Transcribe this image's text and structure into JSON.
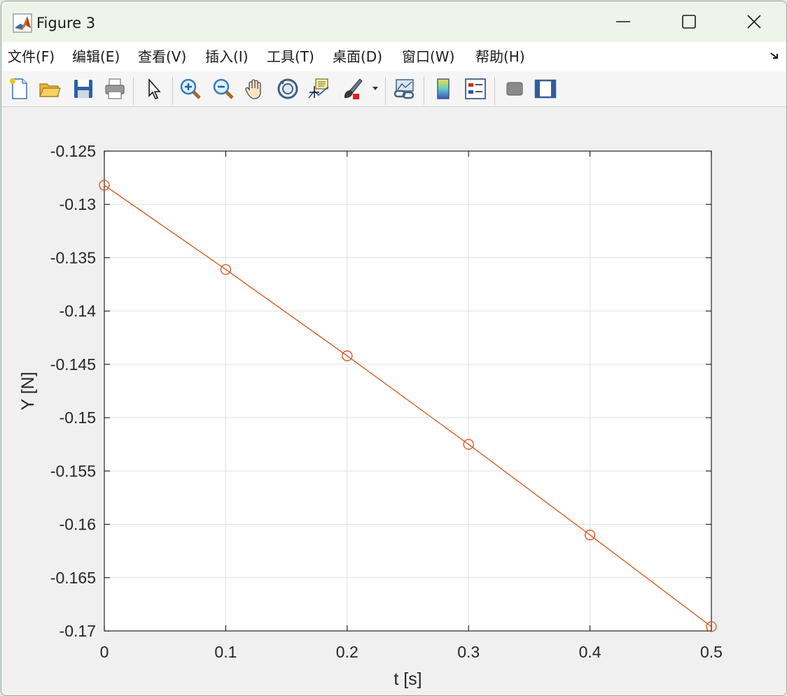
{
  "window": {
    "title": "Figure 3"
  },
  "menu": [
    {
      "label": "文件(F)"
    },
    {
      "label": "编辑(E)"
    },
    {
      "label": "查看(V)"
    },
    {
      "label": "插入(I)"
    },
    {
      "label": "工具(T)"
    },
    {
      "label": "桌面(D)"
    },
    {
      "label": "窗口(W)"
    },
    {
      "label": "帮助(H)"
    }
  ],
  "toolbar": [
    {
      "icon": "new-figure-icon"
    },
    {
      "icon": "open-folder-icon"
    },
    {
      "icon": "save-icon"
    },
    {
      "icon": "print-icon"
    },
    {
      "icon": "edit-pointer-icon"
    },
    {
      "icon": "zoom-in-icon"
    },
    {
      "icon": "zoom-out-icon"
    },
    {
      "icon": "pan-hand-icon"
    },
    {
      "icon": "rotate-3d-icon"
    },
    {
      "icon": "data-cursor-icon"
    },
    {
      "icon": "brush-icon"
    },
    {
      "icon": "link-plot-icon"
    },
    {
      "icon": "colorbar-icon"
    },
    {
      "icon": "legend-icon"
    },
    {
      "icon": "hide-plot-tools-icon"
    },
    {
      "icon": "show-plot-tools-icon"
    }
  ],
  "colors": {
    "series": "#d95319",
    "grid": "#e1e1e1",
    "axes": "#262626"
  },
  "chart_data": {
    "type": "line",
    "title": "",
    "xlabel": "t [s]",
    "ylabel": "Y [N]",
    "xlim": [
      0,
      0.5
    ],
    "ylim": [
      -0.17,
      -0.125
    ],
    "xticks": [
      "0",
      "0.1",
      "0.2",
      "0.3",
      "0.4",
      "0.5"
    ],
    "yticks": [
      "-0.125",
      "-0.13",
      "-0.135",
      "-0.14",
      "-0.145",
      "-0.15",
      "-0.155",
      "-0.16",
      "-0.165",
      "-0.17"
    ],
    "grid": true,
    "marker": "circle",
    "series": [
      {
        "x": [
          0,
          0.1,
          0.2,
          0.3,
          0.4,
          0.5
        ],
        "y": [
          -0.1282,
          -0.1361,
          -0.1442,
          -0.1525,
          -0.161,
          -0.1696
        ]
      }
    ]
  }
}
